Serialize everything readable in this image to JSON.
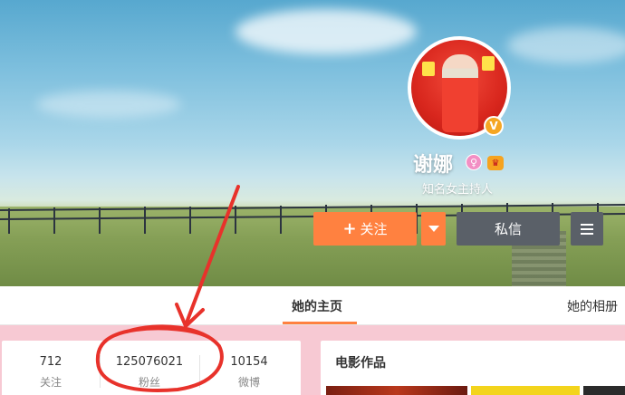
{
  "profile": {
    "name": "谢娜",
    "description": "知名女主持人",
    "verified_badge": "V",
    "gender_icon": "female-icon",
    "vip_icon": "vip-icon"
  },
  "actions": {
    "follow_label": "关注",
    "follow_plus": "+",
    "message_label": "私信"
  },
  "tabs": [
    {
      "label": "她的主页",
      "active": true
    },
    {
      "label": "她的相册",
      "active": false
    }
  ],
  "stats": [
    {
      "value": "712",
      "label": "关注"
    },
    {
      "value": "125076021",
      "label": "粉丝"
    },
    {
      "value": "10154",
      "label": "微博"
    }
  ],
  "works": {
    "title": "电影作品"
  },
  "colors": {
    "accent": "#ff8140",
    "dark_button": "#5a6068",
    "page_background": "#f7c9d3",
    "annotation": "#e8322b"
  }
}
